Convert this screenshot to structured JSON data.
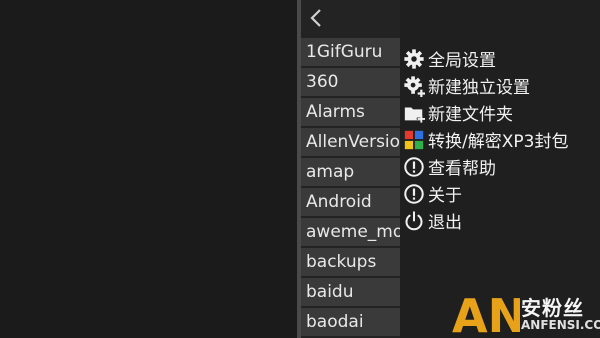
{
  "navigation": {
    "back_icon": "chevron-left-icon"
  },
  "file_list": [
    "1GifGuru",
    "360",
    "Alarms",
    "AllenVersion",
    "amap",
    "Android",
    "aweme_monitor",
    "backups",
    "baidu",
    "baodai"
  ],
  "menu": {
    "items": [
      {
        "label": "全局设置",
        "icon": "gear-icon"
      },
      {
        "label": "新建独立设置",
        "icon": "gear-plus-icon"
      },
      {
        "label": "新建文件夹",
        "icon": "folder-plus-icon"
      },
      {
        "label": "转换/解密XP3封包",
        "icon": "color-grid-icon"
      },
      {
        "label": "查看帮助",
        "icon": "exclamation-circle-icon"
      },
      {
        "label": "关于",
        "icon": "exclamation-circle-icon"
      },
      {
        "label": "退出",
        "icon": "power-icon"
      }
    ]
  },
  "watermark": {
    "logo_text": "AN",
    "cn_text": "安粉丝",
    "en_text": "ANFENSI.COM"
  },
  "colors": {
    "background": "#1b1b1b",
    "list_item": "#3a3a3a",
    "menu_bg": "#1f1f1f",
    "logo": "#e8a21a"
  }
}
